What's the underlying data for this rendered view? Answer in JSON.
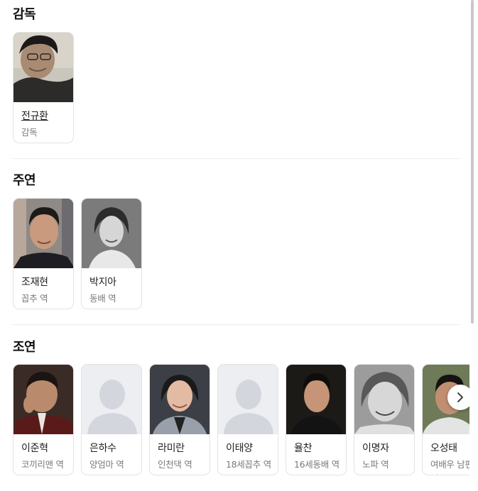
{
  "sections": {
    "director": {
      "title": "감독",
      "people": [
        {
          "name": "전규환",
          "role": "감독"
        }
      ]
    },
    "lead": {
      "title": "주연",
      "people": [
        {
          "name": "조재현",
          "role": "꼽추 역"
        },
        {
          "name": "박지아",
          "role": "동배 역"
        }
      ]
    },
    "supporting": {
      "title": "조연",
      "people": [
        {
          "name": "이준혁",
          "role": "코끼리맨 역"
        },
        {
          "name": "은하수",
          "role": "양엄마 역"
        },
        {
          "name": "라미란",
          "role": "인천댁 역"
        },
        {
          "name": "이태양",
          "role": "18세꼽추 역"
        },
        {
          "name": "율찬",
          "role": "16세동배 역"
        },
        {
          "name": "이명자",
          "role": "노파 역"
        },
        {
          "name": "오성태",
          "role": "여배우 남편 역"
        }
      ]
    }
  },
  "icons": {
    "next": "chevron-right-icon",
    "placeholder": "person-silhouette-icon"
  }
}
